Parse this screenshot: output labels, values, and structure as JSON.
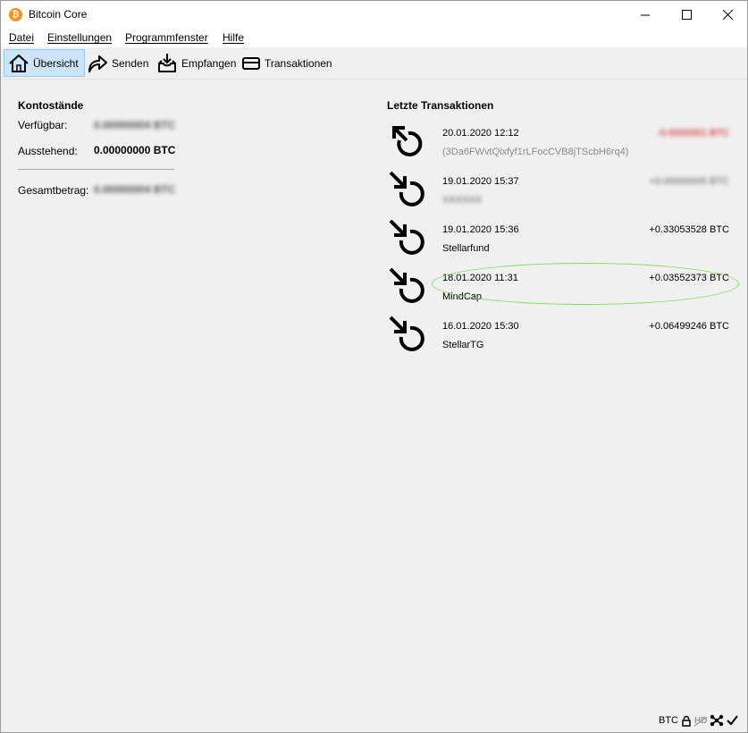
{
  "window": {
    "title": "Bitcoin Core",
    "app_icon": "bitcoin-logo",
    "colors": {
      "brand": "#f7931a",
      "negative": "#cc0000",
      "highlight": "#7ee05a",
      "active_tab_bg": "#cce4f7"
    }
  },
  "menubar": [
    "Datei",
    "Einstellungen",
    "Programmfenster",
    "Hilfe"
  ],
  "toolbar": [
    {
      "label": "Übersicht",
      "icon": "home-icon",
      "active": true
    },
    {
      "label": "Senden",
      "icon": "send-arrow-icon"
    },
    {
      "label": "Empfangen",
      "icon": "receive-inbox-icon"
    },
    {
      "label": "Transaktionen",
      "icon": "transactions-card-icon"
    }
  ],
  "balances": {
    "heading": "Kontostände",
    "available_label": "Verfügbar:",
    "available_value": "0.00000004 BTC",
    "pending_label": "Ausstehend:",
    "pending_value": "0.00000000 BTC",
    "total_label": "Gesamtbetrag:",
    "total_value": "0.00000004 BTC"
  },
  "recent": {
    "heading": "Letzte Transaktionen",
    "items": [
      {
        "direction": "sent",
        "date": "20.01.2020 12:12",
        "description": "(3Da6FWvtQixfyf1rLFocCVB8jTScbH6rq4)",
        "amount": "-0.0000001 BTC",
        "amount_blurred": true,
        "desc_is_address": true
      },
      {
        "direction": "received",
        "date": "19.01.2020 15:37",
        "description": "XXXXXX",
        "desc_blurred": true,
        "amount": "+0.00000005 BTC",
        "amount_blurred": true
      },
      {
        "direction": "received",
        "date": "19.01.2020 15:36",
        "description": "Stellarfund",
        "amount": "+0.33053528 BTC"
      },
      {
        "direction": "received",
        "date": "18.01.2020 11:31",
        "description": "MindCap",
        "amount": "+0.03552373 BTC",
        "highlighted": true
      },
      {
        "direction": "received",
        "date": "16.01.2020 15:30",
        "description": "StellarTG",
        "amount": "+0.06499246 BTC"
      }
    ]
  },
  "statusbar": {
    "unit": "BTC",
    "icons": [
      "lock-icon",
      "hd-disabled-icon",
      "network-icon",
      "synced-check-icon"
    ],
    "hd_label": "HD"
  }
}
